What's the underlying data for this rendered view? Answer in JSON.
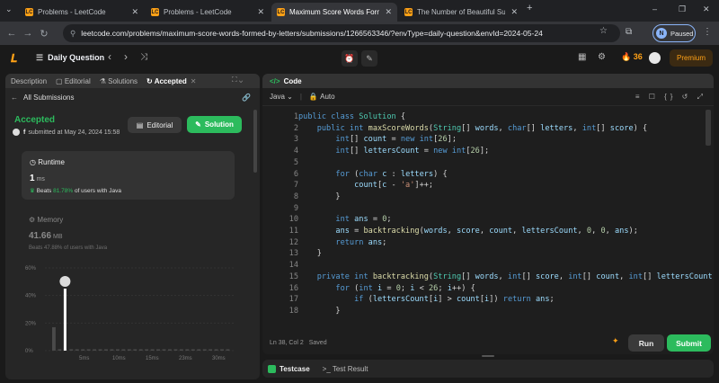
{
  "tabs": [
    {
      "title": "Problems - LeetCode",
      "fav": "LC"
    },
    {
      "title": "Problems - LeetCode",
      "fav": "LC"
    },
    {
      "title": "Maximum Score Words Formed",
      "fav": "LC"
    },
    {
      "title": "The Number of Beautiful Subse",
      "fav": "LC"
    }
  ],
  "tab_close": "✕",
  "new_tab": "+",
  "window_controls": {
    "tablist": "⌄",
    "minimize": "–",
    "restore": "❐",
    "close": "✕"
  },
  "toolbar": {
    "back": "←",
    "forward": "→",
    "reload": "↻",
    "url": "leetcode.com/problems/maximum-score-words-formed-by-letters/submissions/1266563346/?envType=daily-question&envId=2024-05-24",
    "star": "☆",
    "extensions": "⧉",
    "profile_initial": "N",
    "profile_status": "Paused",
    "menu": "⋮"
  },
  "lc_header": {
    "logo": "𝑳",
    "list_icon": "☰",
    "title": "Daily Question",
    "prev": "‹",
    "next": "›",
    "shuffle": "⤨",
    "center_icons": [
      "⏰",
      "✎"
    ],
    "layout_icon": "▦",
    "settings_icon": "⚙",
    "streak_icon": "🔥",
    "streak": "36",
    "premium": "Premium"
  },
  "left_tabs": [
    {
      "label": "Description",
      "icon": "",
      "active": false
    },
    {
      "label": "Editorial",
      "icon": "▢",
      "active": false
    },
    {
      "label": "Solutions",
      "icon": "⚗",
      "active": false
    },
    {
      "label": "Accepted",
      "icon": "↻",
      "active": true
    }
  ],
  "left_tab_close": "✕",
  "left_panel_icons": "⛶ ⌄",
  "all_submissions": {
    "back": "←",
    "label": "All Submissions",
    "link_icon": "🔗"
  },
  "submission": {
    "status": "Accepted",
    "user": "f",
    "submitted_text": "submitted at May 24, 2024 15:58",
    "editorial_label": "Editorial",
    "solution_label": "Solution"
  },
  "runtime": {
    "label": "Runtime",
    "value": "1",
    "unit": "ms",
    "beats_prefix": "Beats",
    "beats_pct": "81.78%",
    "beats_suffix": "of users with Java"
  },
  "memory": {
    "label": "Memory",
    "value": "41.66",
    "unit": "MB",
    "beats_text": "Beats 47.88% of users with Java"
  },
  "chart_data": {
    "type": "bar",
    "y_ticks": [
      "60%",
      "40%",
      "20%",
      "0%"
    ],
    "ylim": [
      0,
      60
    ],
    "x_ticks": [
      "5ms",
      "10ms",
      "15ms",
      "23ms",
      "30ms"
    ],
    "values": [
      17,
      1,
      45,
      1,
      1,
      1,
      1,
      1,
      1,
      1,
      1,
      1,
      1,
      1,
      1,
      1,
      1,
      1,
      1,
      1,
      1,
      1,
      1,
      1,
      1,
      1,
      1,
      1,
      1,
      1,
      1
    ],
    "highlight_index": 2,
    "colors": {
      "highlight": "#ffffff",
      "bar": "#4a4a4a"
    }
  },
  "code_panel": {
    "tab_label": "Code",
    "language": "Java",
    "mode": "Auto",
    "tools": "≡ ☐ {} ↺ ⤢",
    "status": "Ln 38, Col 2",
    "saved": "Saved",
    "run": "Run",
    "submit": "Submit"
  },
  "code_lines": [
    {
      "n": "1",
      "html": "<span class=\"kw\">public class</span> <span class=\"ty\">Solution</span> {"
    },
    {
      "n": "2",
      "html": "    <span class=\"kw\">public int</span> <span class=\"fn\">maxScoreWords</span>(<span class=\"ty\">String</span>[] <span class=\"vr\">words</span>, <span class=\"kw\">char</span>[] <span class=\"vr\">letters</span>, <span class=\"kw\">int</span>[] <span class=\"vr\">score</span>) {"
    },
    {
      "n": "3",
      "html": "        <span class=\"kw\">int</span>[] <span class=\"vr\">count</span> = <span class=\"kw\">new int</span>[<span class=\"nm\">26</span>];"
    },
    {
      "n": "4",
      "html": "        <span class=\"kw\">int</span>[] <span class=\"vr\">lettersCount</span> = <span class=\"kw\">new int</span>[<span class=\"nm\">26</span>];"
    },
    {
      "n": "5",
      "html": ""
    },
    {
      "n": "6",
      "html": "        <span class=\"kw\">for</span> (<span class=\"kw\">char</span> <span class=\"vr\">c</span> : <span class=\"vr\">letters</span>) {"
    },
    {
      "n": "7",
      "html": "            <span class=\"vr\">count</span>[<span class=\"vr\">c</span> - <span class=\"st\">'a'</span>]++;"
    },
    {
      "n": "8",
      "html": "        }"
    },
    {
      "n": "9",
      "html": ""
    },
    {
      "n": "10",
      "html": "        <span class=\"kw\">int</span> <span class=\"vr\">ans</span> = <span class=\"nm\">0</span>;"
    },
    {
      "n": "11",
      "html": "        <span class=\"vr\">ans</span> = <span class=\"fn\">backtracking</span>(<span class=\"vr\">words</span>, <span class=\"vr\">score</span>, <span class=\"vr\">count</span>, <span class=\"vr\">lettersCount</span>, <span class=\"nm\">0</span>, <span class=\"nm\">0</span>, <span class=\"vr\">ans</span>);"
    },
    {
      "n": "12",
      "html": "        <span class=\"kw\">return</span> <span class=\"vr\">ans</span>;"
    },
    {
      "n": "13",
      "html": "    }"
    },
    {
      "n": "14",
      "html": ""
    },
    {
      "n": "15",
      "html": "    <span class=\"kw\">private int</span> <span class=\"fn\">backtracking</span>(<span class=\"ty\">String</span>[] <span class=\"vr\">words</span>, <span class=\"kw\">int</span>[] <span class=\"vr\">score</span>, <span class=\"kw\">int</span>[] <span class=\"vr\">count</span>, <span class=\"kw\">int</span>[] <span class=\"vr\">lettersCount</span>"
    },
    {
      "n": "16",
      "html": "        <span class=\"kw\">for</span> (<span class=\"kw\">int</span> <span class=\"vr\">i</span> = <span class=\"nm\">0</span>; <span class=\"vr\">i</span> &lt; <span class=\"nm\">26</span>; <span class=\"vr\">i</span>++) {"
    },
    {
      "n": "17",
      "html": "            <span class=\"kw\">if</span> (<span class=\"vr\">lettersCount</span>[<span class=\"vr\">i</span>] &gt; <span class=\"vr\">count</span>[<span class=\"vr\">i</span>]) <span class=\"kw\">return</span> <span class=\"vr\">ans</span>;"
    },
    {
      "n": "18",
      "html": "        }"
    }
  ],
  "test_panel": {
    "testcase": "Testcase",
    "result_icon": ">_",
    "result": "Test Result"
  }
}
